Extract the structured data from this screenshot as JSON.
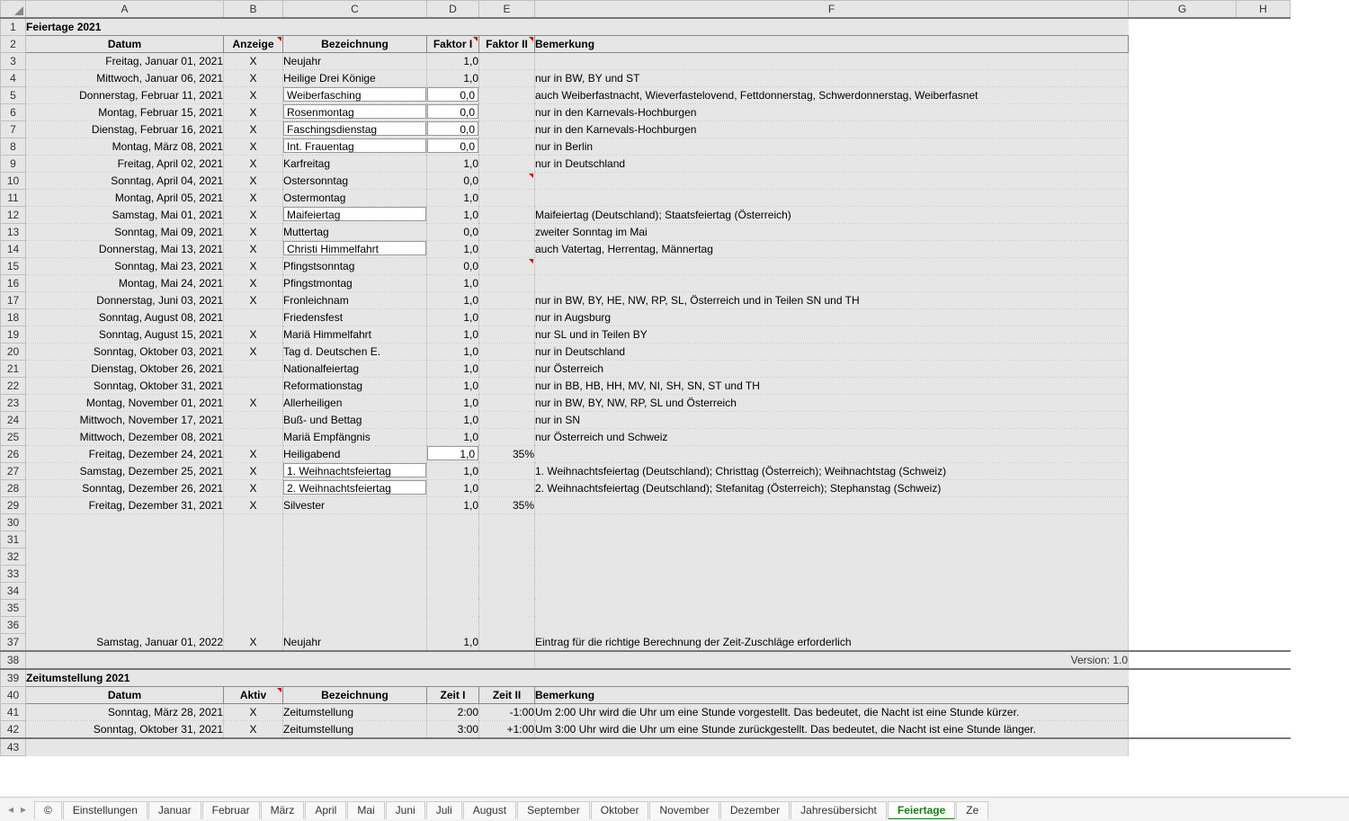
{
  "columns": [
    "A",
    "B",
    "C",
    "D",
    "E",
    "F",
    "G",
    "H"
  ],
  "section1": {
    "title": "Feiertage 2021",
    "headers": {
      "a": "Datum",
      "b": "Anzeige",
      "c": "Bezeichnung",
      "d": "Faktor I",
      "e": "Faktor II",
      "f": "Bemerkung"
    }
  },
  "rows": [
    {
      "r": 3,
      "a": "Freitag, Januar 01, 2021",
      "b": "X",
      "c": "Neujahr",
      "d": "1,0",
      "e": "",
      "f": ""
    },
    {
      "r": 4,
      "a": "Mittwoch, Januar 06, 2021",
      "b": "X",
      "c": "Heilige Drei Könige",
      "d": "1,0",
      "e": "",
      "f": "nur in BW, BY und ST"
    },
    {
      "r": 5,
      "a": "Donnerstag, Februar 11, 2021",
      "b": "X",
      "c": "Weiberfasching",
      "cbox": true,
      "d": "0,0",
      "dbox": true,
      "e": "",
      "f": "auch Weiberfastnacht, Wieverfastelovend, Fettdonnerstag, Schwerdonnerstag, Weiberfasnet"
    },
    {
      "r": 6,
      "a": "Montag, Februar 15, 2021",
      "b": "X",
      "c": "Rosenmontag",
      "cbox": true,
      "d": "0,0",
      "dbox": true,
      "e": "",
      "f": "nur in den Karnevals-Hochburgen"
    },
    {
      "r": 7,
      "a": "Dienstag, Februar 16, 2021",
      "b": "X",
      "c": "Faschingsdienstag",
      "cbox": true,
      "d": "0,0",
      "dbox": true,
      "e": "",
      "f": "nur in den Karnevals-Hochburgen"
    },
    {
      "r": 8,
      "a": "Montag, März 08, 2021",
      "b": "X",
      "c": "Int. Frauentag",
      "cbox": true,
      "d": "0,0",
      "dbox": true,
      "e": "",
      "f": "nur in Berlin"
    },
    {
      "r": 9,
      "a": "Freitag, April 02, 2021",
      "b": "X",
      "c": "Karfreitag",
      "d": "1,0",
      "e": "",
      "f": "nur in Deutschland"
    },
    {
      "r": 10,
      "a": "Sonntag, April 04, 2021",
      "b": "X",
      "c": "Ostersonntag",
      "d": "0,0",
      "e": "",
      "ecm": true,
      "f": ""
    },
    {
      "r": 11,
      "a": "Montag, April 05, 2021",
      "b": "X",
      "c": "Ostermontag",
      "d": "1,0",
      "e": "",
      "f": ""
    },
    {
      "r": 12,
      "a": "Samstag, Mai 01, 2021",
      "b": "X",
      "c": "Maifeiertag",
      "cbox": true,
      "d": "1,0",
      "e": "",
      "f": "Maifeiertag (Deutschland); Staatsfeiertag (Österreich)"
    },
    {
      "r": 13,
      "a": "Sonntag, Mai 09, 2021",
      "b": "X",
      "c": "Muttertag",
      "d": "0,0",
      "e": "",
      "f": "zweiter Sonntag im Mai"
    },
    {
      "r": 14,
      "a": "Donnerstag, Mai 13, 2021",
      "b": "X",
      "c": "Christi Himmelfahrt",
      "cbox": true,
      "d": "1,0",
      "e": "",
      "f": "auch Vatertag, Herrentag, Männertag"
    },
    {
      "r": 15,
      "a": "Sonntag, Mai 23, 2021",
      "b": "X",
      "c": "Pfingstsonntag",
      "d": "0,0",
      "e": "",
      "ecm": true,
      "f": ""
    },
    {
      "r": 16,
      "a": "Montag, Mai 24, 2021",
      "b": "X",
      "c": "Pfingstmontag",
      "d": "1,0",
      "e": "",
      "f": ""
    },
    {
      "r": 17,
      "a": "Donnerstag, Juni 03, 2021",
      "b": "X",
      "c": "Fronleichnam",
      "d": "1,0",
      "e": "",
      "f": "nur in BW, BY, HE, NW, RP, SL, Österreich und in Teilen SN und TH"
    },
    {
      "r": 18,
      "a": "Sonntag, August 08, 2021",
      "b": "",
      "c": "Friedensfest",
      "d": "1,0",
      "e": "",
      "f": "nur in Augsburg"
    },
    {
      "r": 19,
      "a": "Sonntag, August 15, 2021",
      "b": "X",
      "c": "Mariä Himmelfahrt",
      "d": "1,0",
      "e": "",
      "f": "nur SL und in Teilen BY"
    },
    {
      "r": 20,
      "a": "Sonntag, Oktober 03, 2021",
      "b": "X",
      "c": "Tag d. Deutschen E.",
      "d": "1,0",
      "e": "",
      "f": "nur in Deutschland"
    },
    {
      "r": 21,
      "a": "Dienstag, Oktober 26, 2021",
      "b": "",
      "c": "Nationalfeiertag",
      "d": "1,0",
      "e": "",
      "f": "nur Österreich"
    },
    {
      "r": 22,
      "a": "Sonntag, Oktober 31, 2021",
      "b": "",
      "c": "Reformationstag",
      "d": "1,0",
      "e": "",
      "f": "nur in BB, HB, HH, MV, NI, SH, SN, ST und TH"
    },
    {
      "r": 23,
      "a": "Montag, November 01, 2021",
      "b": "X",
      "c": "Allerheiligen",
      "d": "1,0",
      "e": "",
      "f": "nur in BW, BY, NW, RP, SL und Österreich"
    },
    {
      "r": 24,
      "a": "Mittwoch, November 17, 2021",
      "b": "",
      "c": "Buß- und Bettag",
      "d": "1,0",
      "e": "",
      "f": "nur in SN"
    },
    {
      "r": 25,
      "a": "Mittwoch, Dezember 08, 2021",
      "b": "",
      "c": "Mariä Empfängnis",
      "d": "1,0",
      "e": "",
      "f": "nur Österreich und Schweiz"
    },
    {
      "r": 26,
      "a": "Freitag, Dezember 24, 2021",
      "b": "X",
      "c": "Heiligabend",
      "d": "1,0",
      "dbox": true,
      "e": "35%",
      "f": ""
    },
    {
      "r": 27,
      "a": "Samstag, Dezember 25, 2021",
      "b": "X",
      "c": "1. Weihnachtsfeiertag",
      "cbox": true,
      "d": "1,0",
      "e": "",
      "f": "1. Weihnachtsfeiertag (Deutschland); Christtag (Österreich); Weihnachtstag (Schweiz)"
    },
    {
      "r": 28,
      "a": "Sonntag, Dezember 26, 2021",
      "b": "X",
      "c": "2. Weihnachtsfeiertag",
      "cbox": true,
      "d": "1,0",
      "e": "",
      "f": "2. Weihnachtsfeiertag (Deutschland); Stefanitag (Österreich); Stephanstag (Schweiz)"
    },
    {
      "r": 29,
      "a": "Freitag, Dezember 31, 2021",
      "b": "X",
      "c": "Silvester",
      "d": "1,0",
      "e": "35%",
      "f": ""
    }
  ],
  "neujahr_next": {
    "r": 37,
    "a": "Samstag, Januar 01, 2022",
    "b": "X",
    "c": "Neujahr",
    "d": "1,0",
    "f": "Eintrag für die richtige Berechnung der Zeit-Zuschläge erforderlich"
  },
  "version_label": "Version: 1.0",
  "section2": {
    "title": "Zeitumstellung 2021",
    "headers": {
      "a": "Datum",
      "b": "Aktiv",
      "c": "Bezeichnung",
      "d": "Zeit I",
      "e": "Zeit II",
      "f": "Bemerkung"
    },
    "rows": [
      {
        "r": 41,
        "a": "Sonntag, März 28, 2021",
        "b": "X",
        "c": "Zeitumstellung",
        "d": "2:00",
        "e": "-1:00",
        "f": "Um 2:00 Uhr wird die Uhr um eine Stunde vorgestellt. Das bedeutet, die Nacht ist eine Stunde kürzer."
      },
      {
        "r": 42,
        "a": "Sonntag, Oktober 31, 2021",
        "b": "X",
        "c": "Zeitumstellung",
        "d": "3:00",
        "e": "+1:00",
        "f": "Um 3:00 Uhr wird die Uhr um eine Stunde zurückgestellt. Das bedeutet, die Nacht ist eine Stunde länger."
      }
    ]
  },
  "sheet_tabs": [
    "©",
    "Einstellungen",
    "Januar",
    "Februar",
    "März",
    "April",
    "Mai",
    "Juni",
    "Juli",
    "August",
    "September",
    "Oktober",
    "November",
    "Dezember",
    "Jahresübersicht",
    "Feiertage",
    "Ze"
  ],
  "active_tab": "Feiertage"
}
